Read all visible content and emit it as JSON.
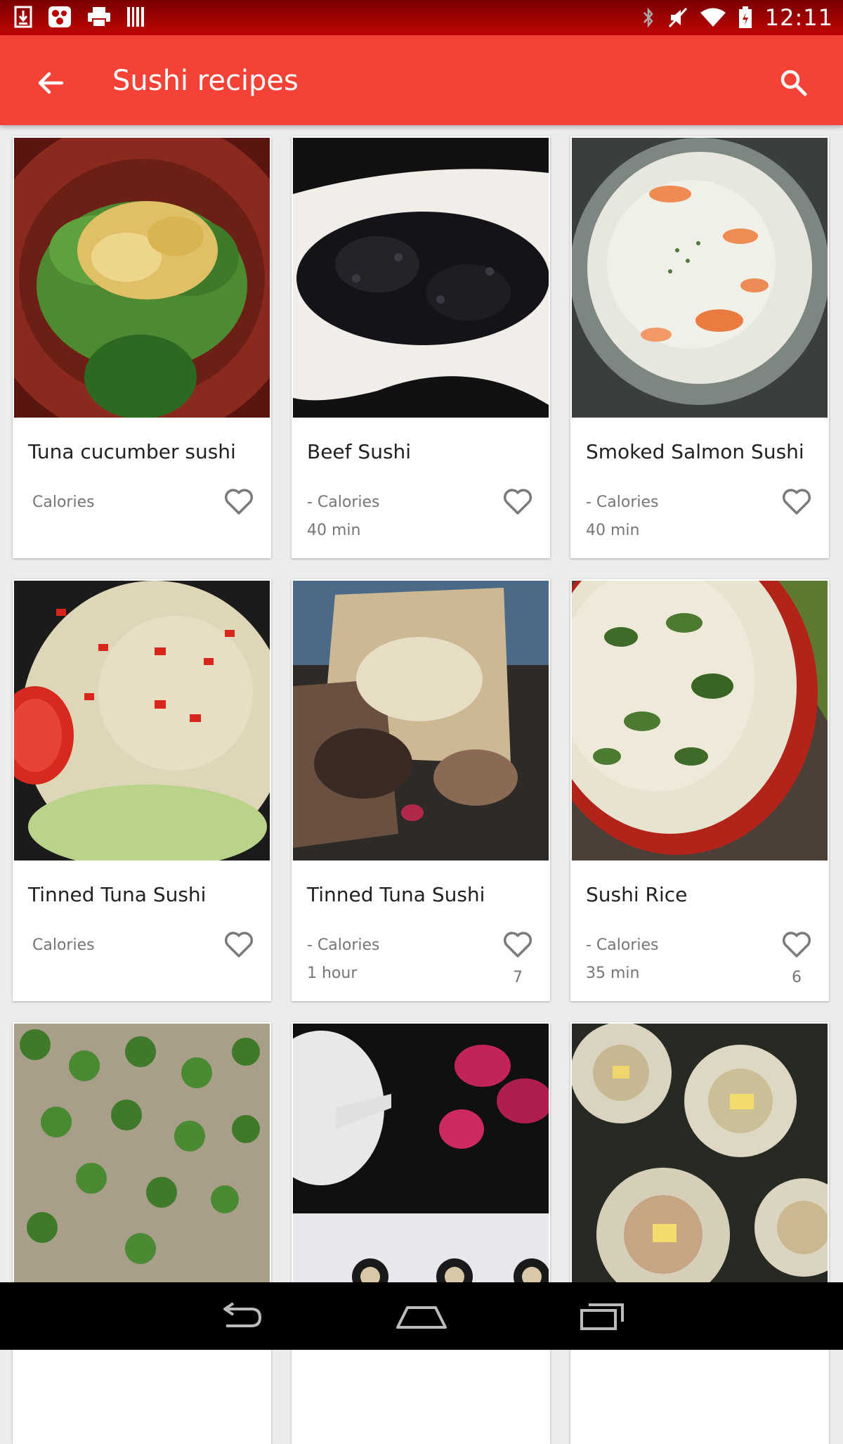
{
  "status_bar": {
    "time": "12:11",
    "left_icons": [
      "download-icon",
      "app-icon",
      "print-icon",
      "barcode-icon"
    ],
    "right_icons": [
      "bluetooth-icon",
      "mute-icon",
      "wifi-icon",
      "battery-icon"
    ]
  },
  "app_bar": {
    "title": "Sushi recipes",
    "back_icon": "arrow-back-icon",
    "search_icon": "search-icon",
    "color": "#f44336"
  },
  "recipes": [
    {
      "title": "Tuna cucumber sushi",
      "calories": "Calories",
      "time": "",
      "favorites": ""
    },
    {
      "title": "Beef Sushi",
      "calories": "- Calories",
      "time": "40 min",
      "favorites": ""
    },
    {
      "title": "Smoked Salmon Sushi",
      "calories": "- Calories",
      "time": "40 min",
      "favorites": ""
    },
    {
      "title": "Tinned Tuna Sushi",
      "calories": "Calories",
      "time": "",
      "favorites": ""
    },
    {
      "title": "Tinned Tuna Sushi",
      "calories": "- Calories",
      "time": "1 hour",
      "favorites": "7"
    },
    {
      "title": "Sushi Rice",
      "calories": "- Calories",
      "time": "35 min",
      "favorites": "6"
    },
    {
      "title": "",
      "calories": "",
      "time": "",
      "favorites": ""
    },
    {
      "title": "",
      "calories": "",
      "time": "",
      "favorites": ""
    },
    {
      "title": "",
      "calories": "",
      "time": "",
      "favorites": ""
    }
  ],
  "nav_bar": {
    "buttons": [
      "back-nav-icon",
      "home-nav-icon",
      "recents-nav-icon"
    ]
  }
}
